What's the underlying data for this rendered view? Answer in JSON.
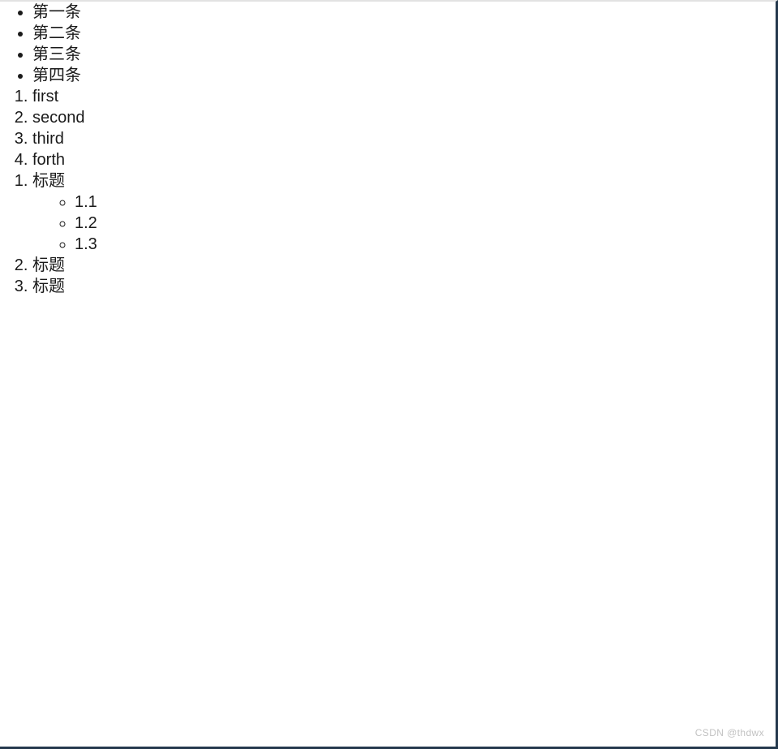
{
  "document": {
    "background_color": "#ffffff",
    "text_color": "#1a1a1a",
    "border_color": "#25394d",
    "top_rule_color": "#e2e2e2"
  },
  "bullet_list": {
    "marker": "disc",
    "items": [
      {
        "label": "第一条"
      },
      {
        "label": "第二条"
      },
      {
        "label": "第三条"
      },
      {
        "label": "第四条"
      }
    ]
  },
  "ordered_list": {
    "marker": "decimal",
    "items": [
      {
        "number": "1.",
        "label": "first"
      },
      {
        "number": "2.",
        "label": "second"
      },
      {
        "number": "3.",
        "label": "third"
      },
      {
        "number": "4.",
        "label": "forth"
      }
    ]
  },
  "nested_list": {
    "marker": "decimal",
    "sub_marker": "circle",
    "items": [
      {
        "number": "1.",
        "label": "标题",
        "children": [
          {
            "label": "1.1"
          },
          {
            "label": "1.2"
          },
          {
            "label": "1.3"
          }
        ]
      },
      {
        "number": "2.",
        "label": "标题",
        "children": []
      },
      {
        "number": "3.",
        "label": "标题",
        "children": []
      }
    ]
  },
  "watermark": {
    "text": "CSDN @thdwx",
    "color": "#c2c2c2"
  }
}
